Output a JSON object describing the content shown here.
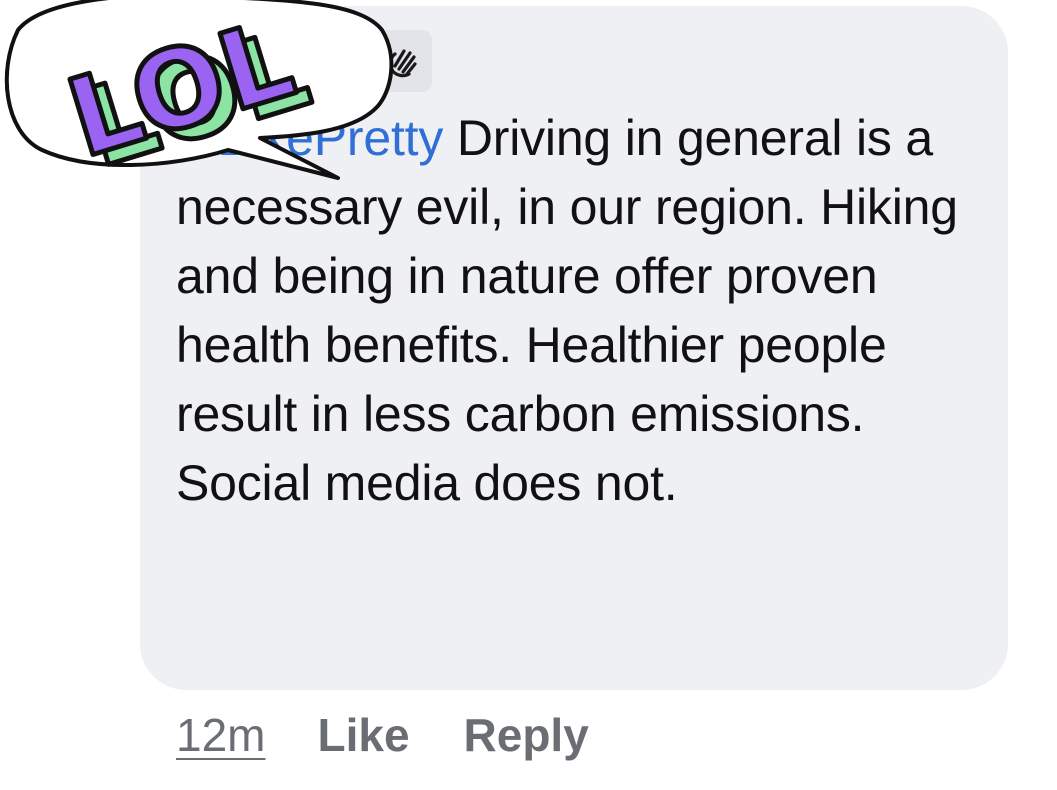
{
  "comment": {
    "author_visible": "a BikePretty",
    "body": " Driving in general is a necessary evil, in our region. Hiking and being in nature offer proven health benefits. Healthier people result in less carbon emissions. Social media does not."
  },
  "sticker": {
    "text": "LOL",
    "colors": {
      "letters": "#9b63f2",
      "shadow": "#8be3a4",
      "outline": "#111111",
      "bubble": "#ffffff"
    }
  },
  "actions": {
    "time": "12m",
    "like": "Like",
    "reply": "Reply"
  },
  "colors": {
    "bubble_bg": "#eff0f4",
    "author_link": "#2f6fd6",
    "action_text": "#6a6d73"
  }
}
